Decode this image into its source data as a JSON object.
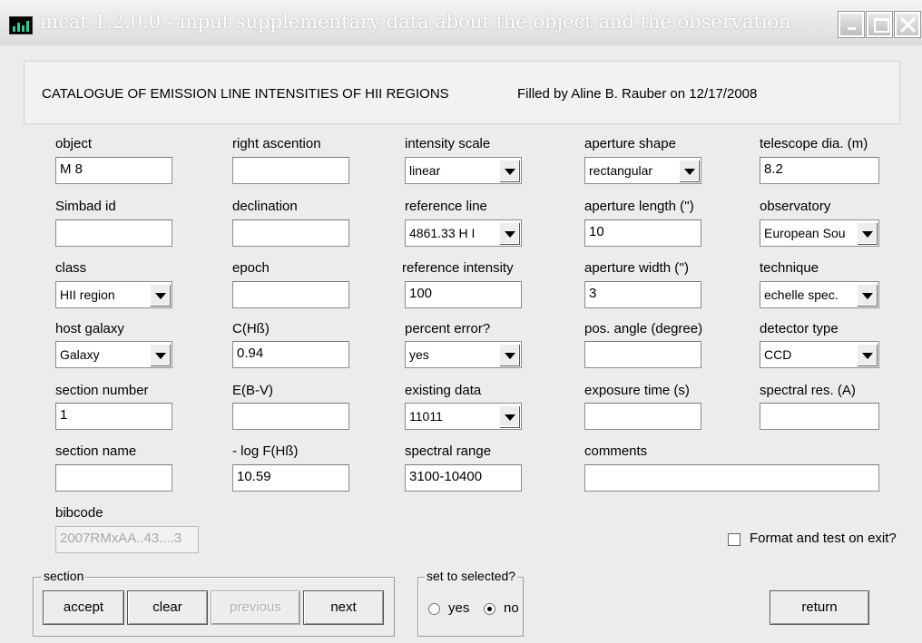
{
  "window": {
    "title": "incat 1.2.0.0 - input supplementary data about the object and the observation",
    "app_icon": "bar-chart-icon",
    "controls": [
      "minimize-icon",
      "maximize-icon",
      "close-icon"
    ]
  },
  "header": {
    "catalogue": "CATALOGUE OF EMISSION LINE INTENSITIES OF HII REGIONS",
    "filled_by": "Filled by Aline B. Rauber on 12/17/2008"
  },
  "fields": {
    "object": {
      "label": "object",
      "value": "M 8"
    },
    "simbad": {
      "label": "Simbad id",
      "value": ""
    },
    "class": {
      "label": "class",
      "value": "HII region"
    },
    "host": {
      "label": "host galaxy",
      "value": "Galaxy"
    },
    "section_number": {
      "label": "section number",
      "value": "1"
    },
    "section_name": {
      "label": "section name",
      "value": ""
    },
    "bibcode": {
      "label": "bibcode",
      "value": "2007RMxAA..43....3"
    },
    "ra": {
      "label": "right ascention",
      "value": ""
    },
    "dec": {
      "label": "declination",
      "value": ""
    },
    "epoch": {
      "label": "epoch",
      "value": ""
    },
    "chb": {
      "label": "C(Hß)",
      "value": "0.94"
    },
    "ebv": {
      "label": "E(B-V)",
      "value": ""
    },
    "logf": {
      "label": "- log F(Hß)",
      "value": "10.59"
    },
    "int_scale": {
      "label": "intensity scale",
      "value": "linear"
    },
    "ref_line": {
      "label": "reference line",
      "value": "4861.33 H I"
    },
    "ref_int": {
      "label": "reference intensity",
      "value": "100"
    },
    "pct_err": {
      "label": "percent error?",
      "value": "yes"
    },
    "existing": {
      "label": "existing data",
      "value": "11011"
    },
    "spec_range": {
      "label": "spectral range",
      "value": "3100-10400"
    },
    "ap_shape": {
      "label": "aperture shape",
      "value": "rectangular"
    },
    "ap_len": {
      "label": "aperture length ('')",
      "value": "10"
    },
    "ap_wid": {
      "label": "aperture width ('')",
      "value": "3"
    },
    "pos_angle": {
      "label": "pos. angle (degree)",
      "value": ""
    },
    "exp_time": {
      "label": "exposure time (s)",
      "value": ""
    },
    "comments": {
      "label": "comments",
      "value": ""
    },
    "tel_dia": {
      "label": "telescope dia. (m)",
      "value": "8.2"
    },
    "observatory": {
      "label": "observatory",
      "value": "European Sou"
    },
    "technique": {
      "label": "technique",
      "value": "echelle spec."
    },
    "detector": {
      "label": "detector type",
      "value": "CCD"
    },
    "spec_res": {
      "label": "spectral res. (A)",
      "value": ""
    }
  },
  "format_test": {
    "label": "Format and test on exit?",
    "checked": false
  },
  "section_group": {
    "legend": "section",
    "accept": "accept",
    "clear": "clear",
    "previous": "previous",
    "next": "next"
  },
  "selected_group": {
    "legend": "set to selected?",
    "yes": "yes",
    "no": "no",
    "selected": "no"
  },
  "return_label": "return"
}
